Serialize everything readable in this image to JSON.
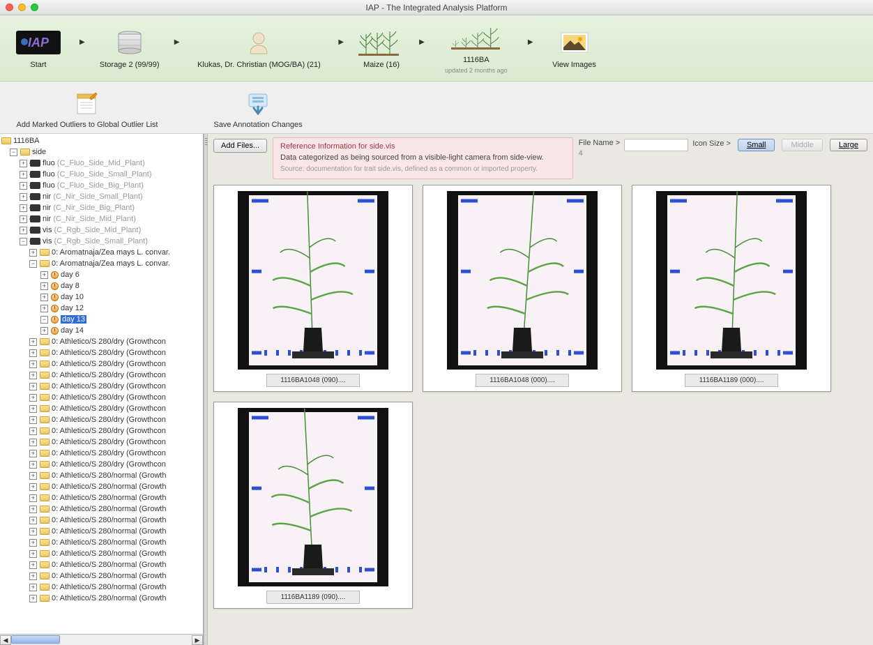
{
  "window": {
    "title": "IAP - The Integrated Analysis Platform"
  },
  "breadcrumb": [
    {
      "label": "Start",
      "sub": ""
    },
    {
      "label": "Storage 2 (99/99)",
      "sub": ""
    },
    {
      "label": "Klukas, Dr. Christian (MOG/BA) (21)",
      "sub": ""
    },
    {
      "label": "Maize (16)",
      "sub": ""
    },
    {
      "label": "1116BA",
      "sub": "updated 2 months ago"
    },
    {
      "label": "View Images",
      "sub": ""
    }
  ],
  "toolbar": {
    "add_outliers": "Add Marked Outliers to Global Outlier List",
    "save_annot": "Save Annotation Changes"
  },
  "tree": {
    "root": "1116BA",
    "side": "side",
    "cameras": [
      {
        "name": "fluo",
        "detail": "(C_Fluo_Side_Mid_Plant)"
      },
      {
        "name": "fluo",
        "detail": "(C_Fluo_Side_Small_Plant)"
      },
      {
        "name": "fluo",
        "detail": "(C_Fluo_Side_Big_Plant)"
      },
      {
        "name": "nir",
        "detail": "(C_Nir_Side_Small_Plant)"
      },
      {
        "name": "nir",
        "detail": "(C_Nir_Side_Big_Plant)"
      },
      {
        "name": "nir",
        "detail": "(C_Nir_Side_Mid_Plant)"
      },
      {
        "name": "vis",
        "detail": "(C_Rgb_Side_Mid_Plant)"
      },
      {
        "name": "vis",
        "detail": "(C_Rgb_Side_Small_Plant)"
      }
    ],
    "aromat1": "0: Aromatnaja/Zea mays L. convar.",
    "aromat2": "0: Aromatnaja/Zea mays L. convar.",
    "days": [
      "day 6",
      "day 8",
      "day 10",
      "day 12",
      "day 13",
      "day 14"
    ],
    "selected_day_index": 4,
    "athletico_dry": "0: Athletico/S 280/dry (Growthcon",
    "athletico_norm": "0: Athletico/S 280/normal (Growth",
    "dry_count": 12,
    "norm_count": 12
  },
  "content": {
    "add_files": "Add Files...",
    "ref_title": "Reference Information for side.vis",
    "ref_desc": "Data categorized as being sourced from a visible-light camera from side-view.",
    "ref_src": "Source: documentation for trait side.vis, defined as a common or imported property.",
    "file_name_label": "File Name >",
    "file_name_value": "",
    "file_count": "4",
    "icon_size_label": "Icon Size >",
    "size_small": "Small",
    "size_middle": "Middle",
    "size_large": "Large"
  },
  "thumbs": [
    {
      "caption": "1116BA1048 (090)...."
    },
    {
      "caption": "1116BA1048 (000)...."
    },
    {
      "caption": "1116BA1189 (000)...."
    },
    {
      "caption": "1116BA1189 (090)...."
    }
  ]
}
